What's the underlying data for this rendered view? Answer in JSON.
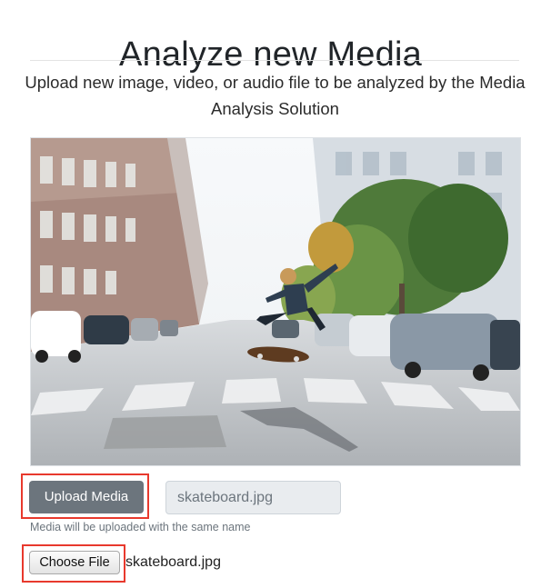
{
  "page": {
    "title": "Analyze new Media",
    "subtitle": "Upload new image, video, or audio file to be analyzed by the Media Analysis Solution"
  },
  "preview": {
    "description": "skateboarder performing a trick on a city street"
  },
  "upload": {
    "button_label": "Upload Media",
    "filename_value": "skateboard.jpg",
    "help_text": "Media will be uploaded with the same name"
  },
  "file_picker": {
    "button_label": "Choose File",
    "selected_file": "skateboard.jpg"
  },
  "colors": {
    "upload_button_bg": "#6c757d",
    "highlight_border": "#e8392d",
    "readonly_field_bg": "#e9ecef"
  }
}
